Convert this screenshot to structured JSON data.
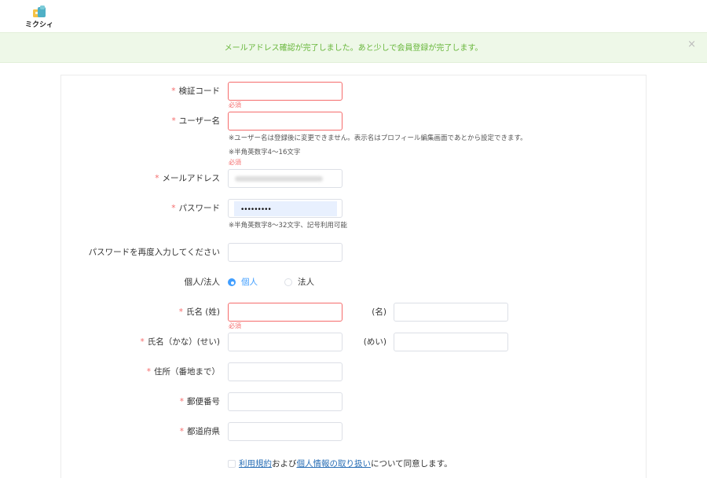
{
  "header": {
    "logo_text": "ミクシィ"
  },
  "alert": {
    "message": "メールアドレス確認が完了しました。あと少しで会員登録が完了します。",
    "close": "×"
  },
  "required_mark": "*",
  "fields": {
    "verification_code": {
      "label": "検証コード",
      "error": "必須"
    },
    "username": {
      "label": "ユーザー名",
      "hint1": "※ユーザー名は登録後に変更できません。表示名はプロフィール編集画面であとから設定できます。",
      "hint2": "※半角英数字4〜16文字",
      "error": "必須"
    },
    "email": {
      "label": "メールアドレス"
    },
    "password": {
      "label": "パスワード",
      "masked_value": "•••••••••",
      "hint": "※半角英数字8〜32文字、記号利用可能"
    },
    "password_confirm": {
      "label": "パスワードを再度入力してください"
    },
    "entity_type": {
      "label": "個人/法人",
      "options": [
        "個人",
        "法人"
      ],
      "selected": "個人"
    },
    "name_kanji": {
      "label": "氏名 (姓)",
      "given_label": "(名)",
      "error": "必須"
    },
    "name_kana": {
      "label": "氏名（かな）(せい)",
      "given_label": "(めい)"
    },
    "address": {
      "label": "住所（番地まで）"
    },
    "postal_code": {
      "label": "郵便番号"
    },
    "prefecture": {
      "label": "都道府県"
    }
  },
  "agreement": {
    "terms_link": "利用規約",
    "and": "および",
    "privacy_link": "個人情報の取り扱い",
    "suffix": "について同意します。"
  },
  "colors": {
    "alert_bg": "#eef8e8",
    "alert_text": "#67b63a",
    "error": "#f56c6c",
    "radio_active": "#409eff",
    "link": "#2a6fb6"
  }
}
